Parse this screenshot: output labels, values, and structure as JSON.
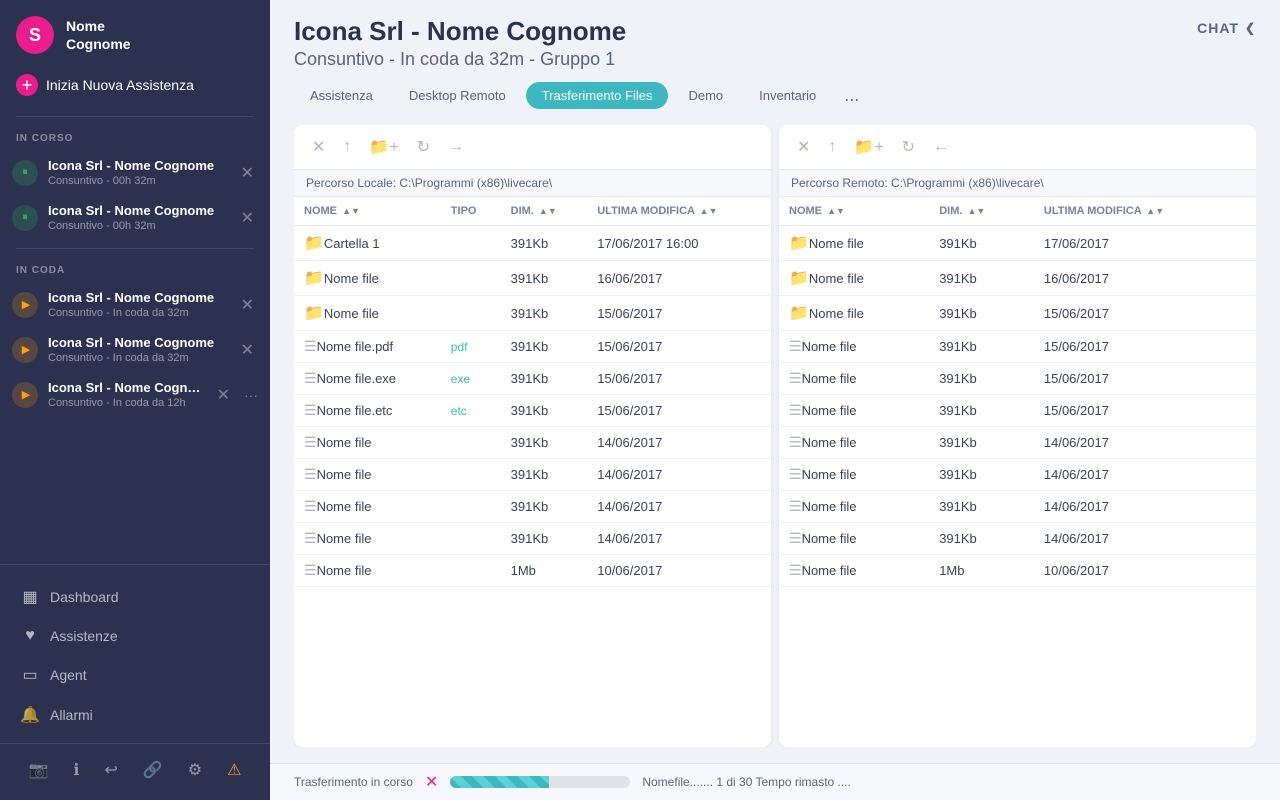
{
  "sidebar": {
    "user": {
      "avatar_letter": "S",
      "name": "Nome\nCognome"
    },
    "new_assistance_label": "Inizia Nuova Assistenza",
    "sections": {
      "in_corso_label": "IN CORSO",
      "in_coda_label": "IN CODA"
    },
    "sessions_active": [
      {
        "title": "Icona Srl - Nome Cognome",
        "subtitle": "Consuntivo - 00h 32m",
        "status": "active"
      },
      {
        "title": "Icona Srl - Nome Cognome",
        "subtitle": "Consuntivo - 00h 32m",
        "status": "active"
      }
    ],
    "sessions_queued": [
      {
        "title": "Icona Srl - Nome Cognome",
        "subtitle": "Consuntivo - In coda da 32m",
        "status": "queued"
      },
      {
        "title": "Icona Srl - Nome Cognome",
        "subtitle": "Consuntivo - In coda da 32m",
        "status": "queued"
      },
      {
        "title": "Icona Srl - Nome Cognome",
        "subtitle": "Consuntivo - In coda da 12h",
        "status": "queued"
      }
    ],
    "nav_items": [
      {
        "label": "Dashboard",
        "icon": "▦"
      },
      {
        "label": "Assistenze",
        "icon": "♥"
      },
      {
        "label": "Agent",
        "icon": "▭"
      },
      {
        "label": "Allarmi",
        "icon": "🔔"
      }
    ],
    "bottom_icons": [
      "📷",
      "ℹ",
      "↩",
      "🔗",
      "⚙",
      "⚠"
    ]
  },
  "header": {
    "title": "Icona Srl - Nome Cognome",
    "subtitle": "Consuntivo - In coda da 32m - Gruppo 1",
    "chat_label": "CHAT"
  },
  "tabs": [
    {
      "label": "Assistenza",
      "active": false
    },
    {
      "label": "Desktop Remoto",
      "active": false
    },
    {
      "label": "Trasferimento Files",
      "active": true
    },
    {
      "label": "Demo",
      "active": false
    },
    {
      "label": "Inventario",
      "active": false
    }
  ],
  "tabs_more_label": "...",
  "local_panel": {
    "path": "Percorso Locale: C:\\Programmi (x86)\\livecare\\",
    "columns": [
      "NOME",
      "TIPO",
      "DIM.",
      "ULTIMA MODIFICA"
    ],
    "files": [
      {
        "name": "Cartella 1",
        "type": "folder",
        "size": "391Kb",
        "date": "17/06/2017 16:00"
      },
      {
        "name": "Nome file",
        "type": "folder",
        "size": "391Kb",
        "date": "16/06/2017"
      },
      {
        "name": "Nome file",
        "type": "folder",
        "size": "391Kb",
        "date": "15/06/2017"
      },
      {
        "name": "Nome file.pdf",
        "type": "pdf",
        "size": "391Kb",
        "date": "15/06/2017"
      },
      {
        "name": "Nome file.exe",
        "type": "exe",
        "size": "391Kb",
        "date": "15/06/2017"
      },
      {
        "name": "Nome file.etc",
        "type": "etc",
        "size": "391Kb",
        "date": "15/06/2017"
      },
      {
        "name": "Nome file",
        "type": "file",
        "size": "391Kb",
        "date": "14/06/2017"
      },
      {
        "name": "Nome file",
        "type": "file",
        "size": "391Kb",
        "date": "14/06/2017"
      },
      {
        "name": "Nome file",
        "type": "file",
        "size": "391Kb",
        "date": "14/06/2017"
      },
      {
        "name": "Nome file",
        "type": "file",
        "size": "391Kb",
        "date": "14/06/2017"
      },
      {
        "name": "Nome file",
        "type": "file",
        "size": "1Mb",
        "date": "10/06/2017"
      }
    ]
  },
  "remote_panel": {
    "path": "Percorso Remoto: C:\\Programmi (x86)\\livecare\\",
    "columns": [
      "NOME",
      "DIM.",
      "ULTIMA MODIFICA"
    ],
    "files": [
      {
        "name": "Nome file",
        "type": "folder",
        "size": "391Kb",
        "date": "17/06/2017"
      },
      {
        "name": "Nome file",
        "type": "folder",
        "size": "391Kb",
        "date": "16/06/2017"
      },
      {
        "name": "Nome file",
        "type": "folder",
        "size": "391Kb",
        "date": "15/06/2017"
      },
      {
        "name": "Nome file",
        "type": "file",
        "size": "391Kb",
        "date": "15/06/2017"
      },
      {
        "name": "Nome file",
        "type": "file",
        "size": "391Kb",
        "date": "15/06/2017"
      },
      {
        "name": "Nome file",
        "type": "file",
        "size": "391Kb",
        "date": "15/06/2017"
      },
      {
        "name": "Nome file",
        "type": "file",
        "size": "391Kb",
        "date": "14/06/2017"
      },
      {
        "name": "Nome file",
        "type": "file",
        "size": "391Kb",
        "date": "14/06/2017"
      },
      {
        "name": "Nome file",
        "type": "file",
        "size": "391Kb",
        "date": "14/06/2017"
      },
      {
        "name": "Nome file",
        "type": "file",
        "size": "391Kb",
        "date": "14/06/2017"
      },
      {
        "name": "Nome file",
        "type": "file",
        "size": "1Mb",
        "date": "10/06/2017"
      }
    ]
  },
  "transfer_status": {
    "label": "Trasferimento in corso",
    "file_info": "Nomefile....... 1 di 30 Tempo rimasto ....",
    "progress_percent": 55
  }
}
